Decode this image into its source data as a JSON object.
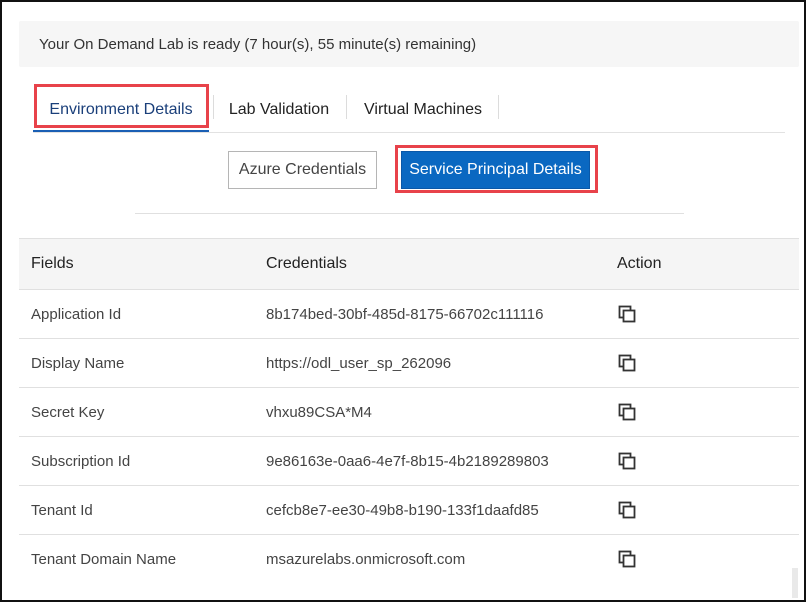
{
  "banner": {
    "text": "Your On Demand Lab is ready (7 hour(s), 55 minute(s) remaining)"
  },
  "tabs": [
    {
      "label": "Environment Details",
      "active": true
    },
    {
      "label": "Lab Validation",
      "active": false
    },
    {
      "label": "Virtual Machines",
      "active": false
    }
  ],
  "subtabs": {
    "azure_credentials": "Azure Credentials",
    "service_principal": "Service Principal Details"
  },
  "table": {
    "headers": {
      "fields": "Fields",
      "credentials": "Credentials",
      "action": "Action"
    },
    "rows": [
      {
        "field": "Application Id",
        "value": "8b174bed-30bf-485d-8175-66702c111116"
      },
      {
        "field": "Display Name",
        "value": "https://odl_user_sp_262096"
      },
      {
        "field": "Secret Key",
        "value": "vhxu89CSA*M4"
      },
      {
        "field": "Subscription Id",
        "value": "9e86163e-0aa6-4e7f-8b15-4b2189289803"
      },
      {
        "field": "Tenant Id",
        "value": "cefcb8e7-ee30-49b8-b190-133f1daafd85"
      },
      {
        "field": "Tenant Domain Name",
        "value": "msazurelabs.onmicrosoft.com"
      }
    ]
  },
  "colors": {
    "highlight": "#e8424a",
    "primary_button": "#0a68c1",
    "active_tab_text": "#1a3f7a"
  },
  "icons": {
    "copy": "copy-icon"
  }
}
